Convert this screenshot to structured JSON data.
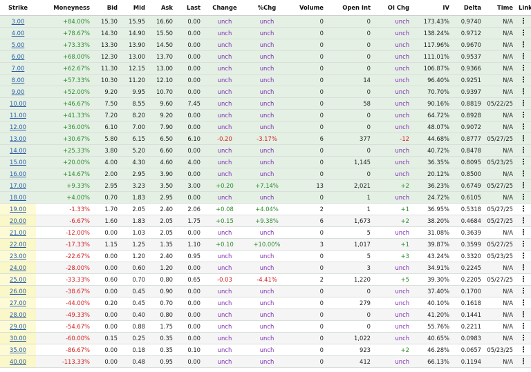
{
  "headers": {
    "strike": "Strike",
    "moneyness": "Moneyness",
    "bid": "Bid",
    "mid": "Mid",
    "ask": "Ask",
    "last": "Last",
    "change": "Change",
    "pct_chg": "%Chg",
    "volume": "Volume",
    "open_int": "Open Int",
    "oi_chg": "OI Chg",
    "iv": "IV",
    "delta": "Delta",
    "time": "Time",
    "links": "Links"
  },
  "links_icon": "vertical-ellipsis-icon",
  "links_glyph": "⋮",
  "colors": {
    "positive": "#2e8b2e",
    "negative": "#d42020",
    "unchanged": "#7d2bb3",
    "in_the_money_bg": "#e4f0e4",
    "link": "#2a5ea8"
  },
  "rows": [
    {
      "strike": "3.00",
      "moneyness": "+84.00%",
      "bid": "15.30",
      "mid": "15.95",
      "ask": "16.60",
      "last": "0.00",
      "change": "unch",
      "pct": "unch",
      "volume": "0",
      "open_int": "0",
      "oi_chg": "unch",
      "iv": "173.43%",
      "delta": "0.9740",
      "time": "N/A",
      "itm": true
    },
    {
      "strike": "4.00",
      "moneyness": "+78.67%",
      "bid": "14.30",
      "mid": "14.90",
      "ask": "15.50",
      "last": "0.00",
      "change": "unch",
      "pct": "unch",
      "volume": "0",
      "open_int": "0",
      "oi_chg": "unch",
      "iv": "138.24%",
      "delta": "0.9712",
      "time": "N/A",
      "itm": true
    },
    {
      "strike": "5.00",
      "moneyness": "+73.33%",
      "bid": "13.30",
      "mid": "13.90",
      "ask": "14.50",
      "last": "0.00",
      "change": "unch",
      "pct": "unch",
      "volume": "0",
      "open_int": "0",
      "oi_chg": "unch",
      "iv": "117.96%",
      "delta": "0.9670",
      "time": "N/A",
      "itm": true
    },
    {
      "strike": "6.00",
      "moneyness": "+68.00%",
      "bid": "12.30",
      "mid": "13.00",
      "ask": "13.70",
      "last": "0.00",
      "change": "unch",
      "pct": "unch",
      "volume": "0",
      "open_int": "0",
      "oi_chg": "unch",
      "iv": "111.01%",
      "delta": "0.9537",
      "time": "N/A",
      "itm": true
    },
    {
      "strike": "7.00",
      "moneyness": "+62.67%",
      "bid": "11.30",
      "mid": "12.15",
      "ask": "13.00",
      "last": "0.00",
      "change": "unch",
      "pct": "unch",
      "volume": "0",
      "open_int": "0",
      "oi_chg": "unch",
      "iv": "106.87%",
      "delta": "0.9366",
      "time": "N/A",
      "itm": true
    },
    {
      "strike": "8.00",
      "moneyness": "+57.33%",
      "bid": "10.30",
      "mid": "11.20",
      "ask": "12.10",
      "last": "0.00",
      "change": "unch",
      "pct": "unch",
      "volume": "0",
      "open_int": "14",
      "oi_chg": "unch",
      "iv": "96.40%",
      "delta": "0.9251",
      "time": "N/A",
      "itm": true
    },
    {
      "strike": "9.00",
      "moneyness": "+52.00%",
      "bid": "9.20",
      "mid": "9.95",
      "ask": "10.70",
      "last": "0.00",
      "change": "unch",
      "pct": "unch",
      "volume": "0",
      "open_int": "0",
      "oi_chg": "unch",
      "iv": "70.70%",
      "delta": "0.9397",
      "time": "N/A",
      "itm": true
    },
    {
      "strike": "10.00",
      "moneyness": "+46.67%",
      "bid": "7.50",
      "mid": "8.55",
      "ask": "9.60",
      "last": "7.45",
      "change": "unch",
      "pct": "unch",
      "volume": "0",
      "open_int": "58",
      "oi_chg": "unch",
      "iv": "90.16%",
      "delta": "0.8819",
      "time": "05/22/25",
      "itm": true
    },
    {
      "strike": "11.00",
      "moneyness": "+41.33%",
      "bid": "7.20",
      "mid": "8.20",
      "ask": "9.20",
      "last": "0.00",
      "change": "unch",
      "pct": "unch",
      "volume": "0",
      "open_int": "0",
      "oi_chg": "unch",
      "iv": "64.72%",
      "delta": "0.8928",
      "time": "N/A",
      "itm": true
    },
    {
      "strike": "12.00",
      "moneyness": "+36.00%",
      "bid": "6.10",
      "mid": "7.00",
      "ask": "7.90",
      "last": "0.00",
      "change": "unch",
      "pct": "unch",
      "volume": "0",
      "open_int": "0",
      "oi_chg": "unch",
      "iv": "48.07%",
      "delta": "0.9072",
      "time": "N/A",
      "itm": true
    },
    {
      "strike": "13.00",
      "moneyness": "+30.67%",
      "bid": "5.80",
      "mid": "6.15",
      "ask": "6.50",
      "last": "6.10",
      "change": "-0.20",
      "pct": "-3.17%",
      "volume": "6",
      "open_int": "377",
      "oi_chg": "-12",
      "iv": "44.68%",
      "delta": "0.8777",
      "time": "05/27/25",
      "itm": true
    },
    {
      "strike": "14.00",
      "moneyness": "+25.33%",
      "bid": "3.80",
      "mid": "5.20",
      "ask": "6.60",
      "last": "0.00",
      "change": "unch",
      "pct": "unch",
      "volume": "0",
      "open_int": "0",
      "oi_chg": "unch",
      "iv": "40.72%",
      "delta": "0.8478",
      "time": "N/A",
      "itm": true
    },
    {
      "strike": "15.00",
      "moneyness": "+20.00%",
      "bid": "4.00",
      "mid": "4.30",
      "ask": "4.60",
      "last": "4.00",
      "change": "unch",
      "pct": "unch",
      "volume": "0",
      "open_int": "1,145",
      "oi_chg": "unch",
      "iv": "36.35%",
      "delta": "0.8095",
      "time": "05/23/25",
      "itm": true
    },
    {
      "strike": "16.00",
      "moneyness": "+14.67%",
      "bid": "2.00",
      "mid": "2.95",
      "ask": "3.90",
      "last": "0.00",
      "change": "unch",
      "pct": "unch",
      "volume": "0",
      "open_int": "0",
      "oi_chg": "unch",
      "iv": "20.12%",
      "delta": "0.8500",
      "time": "N/A",
      "itm": true
    },
    {
      "strike": "17.00",
      "moneyness": "+9.33%",
      "bid": "2.95",
      "mid": "3.23",
      "ask": "3.50",
      "last": "3.00",
      "change": "+0.20",
      "pct": "+7.14%",
      "volume": "13",
      "open_int": "2,021",
      "oi_chg": "+2",
      "iv": "36.23%",
      "delta": "0.6749",
      "time": "05/27/25",
      "itm": true
    },
    {
      "strike": "18.00",
      "moneyness": "+4.00%",
      "bid": "0.70",
      "mid": "1.83",
      "ask": "2.95",
      "last": "0.00",
      "change": "unch",
      "pct": "unch",
      "volume": "0",
      "open_int": "1",
      "oi_chg": "unch",
      "iv": "24.72%",
      "delta": "0.6105",
      "time": "N/A",
      "itm": true
    },
    {
      "strike": "19.00",
      "moneyness": "-1.33%",
      "bid": "1.70",
      "mid": "2.05",
      "ask": "2.40",
      "last": "2.06",
      "change": "+0.08",
      "pct": "+4.04%",
      "volume": "2",
      "open_int": "1",
      "oi_chg": "+1",
      "iv": "36.95%",
      "delta": "0.5318",
      "time": "05/27/25",
      "itm": false
    },
    {
      "strike": "20.00",
      "moneyness": "-6.67%",
      "bid": "1.60",
      "mid": "1.83",
      "ask": "2.05",
      "last": "1.75",
      "change": "+0.15",
      "pct": "+9.38%",
      "volume": "6",
      "open_int": "1,673",
      "oi_chg": "+2",
      "iv": "38.20%",
      "delta": "0.4684",
      "time": "05/27/25",
      "itm": false
    },
    {
      "strike": "21.00",
      "moneyness": "-12.00%",
      "bid": "0.00",
      "mid": "1.03",
      "ask": "2.05",
      "last": "0.00",
      "change": "unch",
      "pct": "unch",
      "volume": "0",
      "open_int": "5",
      "oi_chg": "unch",
      "iv": "31.08%",
      "delta": "0.3639",
      "time": "N/A",
      "itm": false
    },
    {
      "strike": "22.00",
      "moneyness": "-17.33%",
      "bid": "1.15",
      "mid": "1.25",
      "ask": "1.35",
      "last": "1.10",
      "change": "+0.10",
      "pct": "+10.00%",
      "volume": "3",
      "open_int": "1,017",
      "oi_chg": "+1",
      "iv": "39.87%",
      "delta": "0.3599",
      "time": "05/27/25",
      "itm": false
    },
    {
      "strike": "23.00",
      "moneyness": "-22.67%",
      "bid": "0.00",
      "mid": "1.20",
      "ask": "2.40",
      "last": "0.95",
      "change": "unch",
      "pct": "unch",
      "volume": "0",
      "open_int": "5",
      "oi_chg": "+3",
      "iv": "43.24%",
      "delta": "0.3320",
      "time": "05/23/25",
      "itm": false
    },
    {
      "strike": "24.00",
      "moneyness": "-28.00%",
      "bid": "0.00",
      "mid": "0.60",
      "ask": "1.20",
      "last": "0.00",
      "change": "unch",
      "pct": "unch",
      "volume": "0",
      "open_int": "3",
      "oi_chg": "unch",
      "iv": "34.91%",
      "delta": "0.2245",
      "time": "N/A",
      "itm": false
    },
    {
      "strike": "25.00",
      "moneyness": "-33.33%",
      "bid": "0.60",
      "mid": "0.70",
      "ask": "0.80",
      "last": "0.65",
      "change": "-0.03",
      "pct": "-4.41%",
      "volume": "2",
      "open_int": "1,220",
      "oi_chg": "+5",
      "iv": "39.30%",
      "delta": "0.2205",
      "time": "05/27/25",
      "itm": false
    },
    {
      "strike": "26.00",
      "moneyness": "-38.67%",
      "bid": "0.00",
      "mid": "0.45",
      "ask": "0.90",
      "last": "0.00",
      "change": "unch",
      "pct": "unch",
      "volume": "0",
      "open_int": "0",
      "oi_chg": "unch",
      "iv": "37.40%",
      "delta": "0.1700",
      "time": "N/A",
      "itm": false
    },
    {
      "strike": "27.00",
      "moneyness": "-44.00%",
      "bid": "0.20",
      "mid": "0.45",
      "ask": "0.70",
      "last": "0.00",
      "change": "unch",
      "pct": "unch",
      "volume": "0",
      "open_int": "279",
      "oi_chg": "unch",
      "iv": "40.10%",
      "delta": "0.1618",
      "time": "N/A",
      "itm": false
    },
    {
      "strike": "28.00",
      "moneyness": "-49.33%",
      "bid": "0.00",
      "mid": "0.40",
      "ask": "0.80",
      "last": "0.00",
      "change": "unch",
      "pct": "unch",
      "volume": "0",
      "open_int": "0",
      "oi_chg": "unch",
      "iv": "41.20%",
      "delta": "0.1441",
      "time": "N/A",
      "itm": false
    },
    {
      "strike": "29.00",
      "moneyness": "-54.67%",
      "bid": "0.00",
      "mid": "0.88",
      "ask": "1.75",
      "last": "0.00",
      "change": "unch",
      "pct": "unch",
      "volume": "0",
      "open_int": "0",
      "oi_chg": "unch",
      "iv": "55.76%",
      "delta": "0.2211",
      "time": "N/A",
      "itm": false
    },
    {
      "strike": "30.00",
      "moneyness": "-60.00%",
      "bid": "0.15",
      "mid": "0.25",
      "ask": "0.35",
      "last": "0.00",
      "change": "unch",
      "pct": "unch",
      "volume": "0",
      "open_int": "1,022",
      "oi_chg": "unch",
      "iv": "40.65%",
      "delta": "0.0983",
      "time": "N/A",
      "itm": false
    },
    {
      "strike": "35.00",
      "moneyness": "-86.67%",
      "bid": "0.00",
      "mid": "0.18",
      "ask": "0.35",
      "last": "0.10",
      "change": "unch",
      "pct": "unch",
      "volume": "0",
      "open_int": "923",
      "oi_chg": "+2",
      "iv": "46.28%",
      "delta": "0.0657",
      "time": "05/23/25",
      "itm": false
    },
    {
      "strike": "40.00",
      "moneyness": "-113.33%",
      "bid": "0.00",
      "mid": "0.48",
      "ask": "0.95",
      "last": "0.00",
      "change": "unch",
      "pct": "unch",
      "volume": "0",
      "open_int": "412",
      "oi_chg": "unch",
      "iv": "66.13%",
      "delta": "0.1194",
      "time": "N/A",
      "itm": false
    }
  ]
}
